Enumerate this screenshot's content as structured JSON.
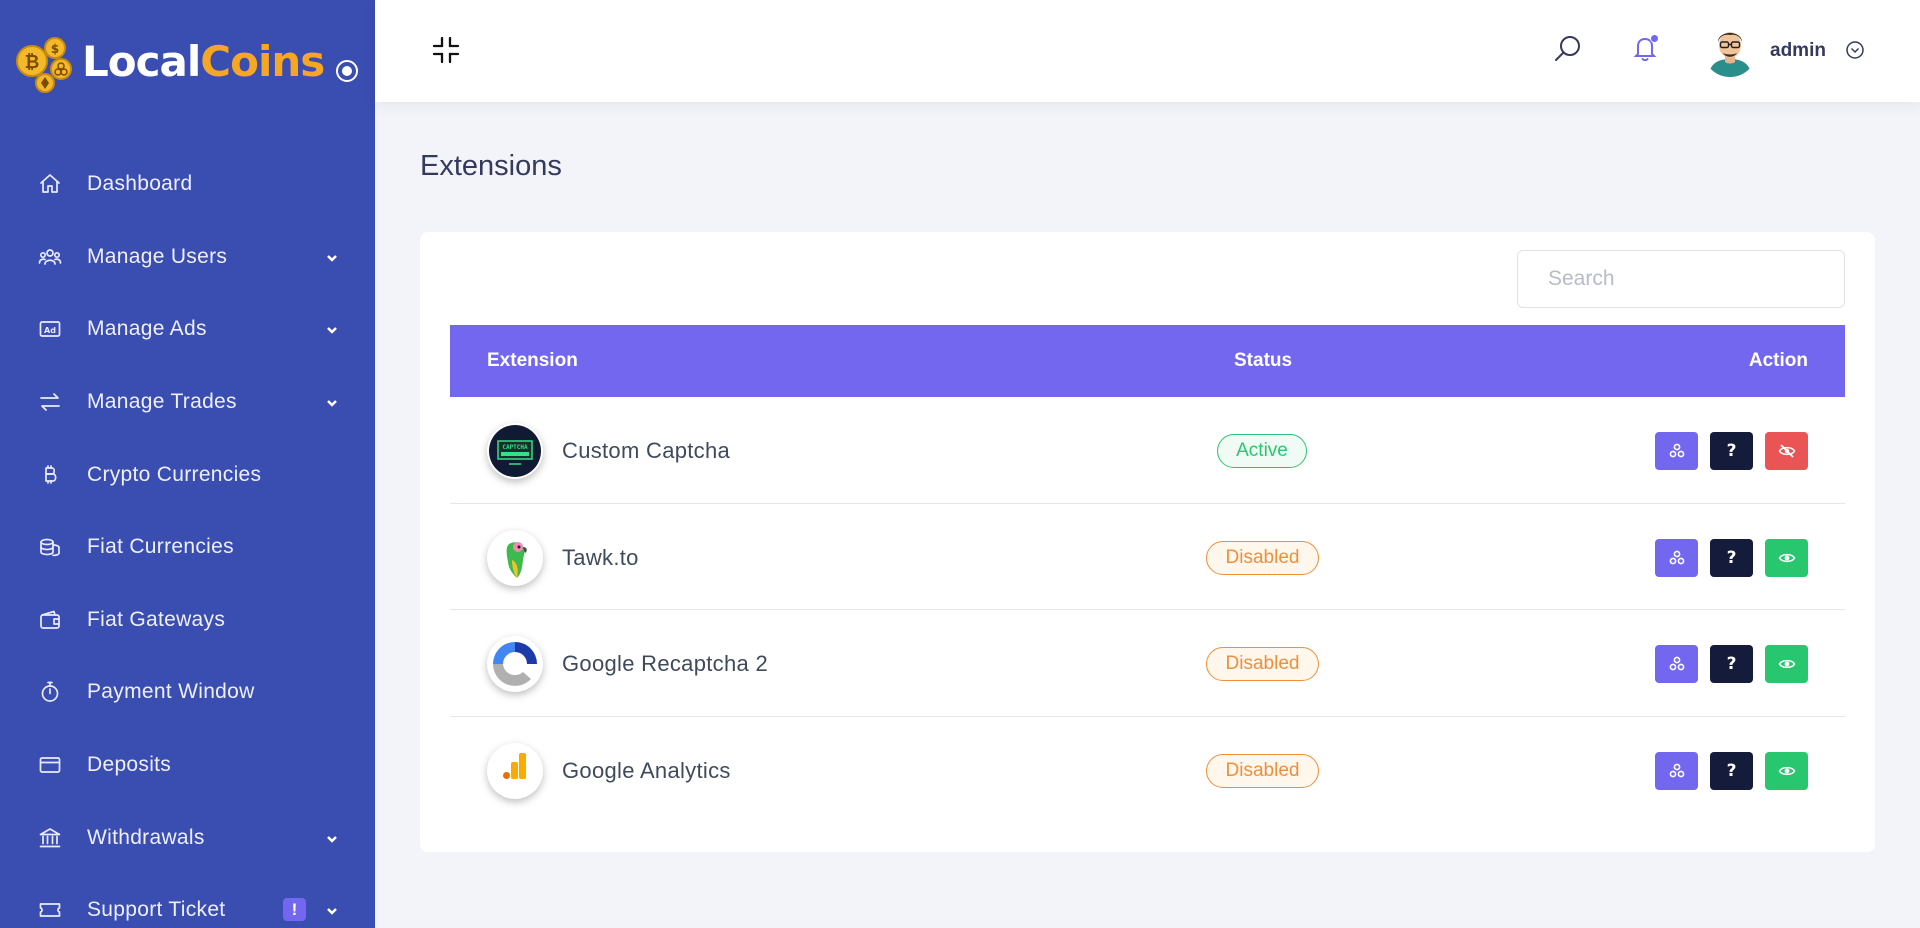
{
  "brand": {
    "name_part1": "Local",
    "name_part2": "Coins"
  },
  "sidebar": {
    "items": [
      {
        "label": "Dashboard",
        "icon": "home-icon",
        "has_submenu": false
      },
      {
        "label": "Manage Users",
        "icon": "users-icon",
        "has_submenu": true
      },
      {
        "label": "Manage Ads",
        "icon": "ad-icon",
        "has_submenu": true
      },
      {
        "label": "Manage Trades",
        "icon": "exchange-icon",
        "has_submenu": true
      },
      {
        "label": "Crypto Currencies",
        "icon": "bitcoin-icon",
        "has_submenu": false
      },
      {
        "label": "Fiat Currencies",
        "icon": "coins-icon",
        "has_submenu": false
      },
      {
        "label": "Fiat Gateways",
        "icon": "wallet-icon",
        "has_submenu": false
      },
      {
        "label": "Payment Window",
        "icon": "stopwatch-icon",
        "has_submenu": false
      },
      {
        "label": "Deposits",
        "icon": "credit-card-icon",
        "has_submenu": false
      },
      {
        "label": "Withdrawals",
        "icon": "bank-icon",
        "has_submenu": true
      },
      {
        "label": "Support Ticket",
        "icon": "ticket-icon",
        "has_submenu": true,
        "badge": "!"
      }
    ]
  },
  "topbar": {
    "user_name": "admin",
    "icons": [
      "collapse-icon",
      "search-icon",
      "bell-icon",
      "avatar",
      "chevron-down-icon"
    ]
  },
  "page": {
    "title": "Extensions"
  },
  "search": {
    "placeholder": "Search"
  },
  "table": {
    "headers": {
      "extension": "Extension",
      "status": "Status",
      "action": "Action"
    },
    "rows": [
      {
        "name": "Custom Captcha",
        "status": "Active",
        "status_type": "active",
        "logo": "captcha-logo",
        "toggle_action": "disable"
      },
      {
        "name": "Tawk.to",
        "status": "Disabled",
        "status_type": "disabled",
        "logo": "tawkto-parrot-logo",
        "toggle_action": "enable"
      },
      {
        "name": "Google Recaptcha 2",
        "status": "Disabled",
        "status_type": "disabled",
        "logo": "recaptcha-logo",
        "toggle_action": "enable"
      },
      {
        "name": "Google Analytics",
        "status": "Disabled",
        "status_type": "disabled",
        "logo": "google-analytics-logo",
        "toggle_action": "enable"
      }
    ]
  },
  "colors": {
    "sidebar_bg": "#3a4db1",
    "primary": "#7367f0",
    "success": "#28c76f",
    "danger": "#ea5455",
    "warning": "#f08f3a",
    "dark": "#151b3b",
    "brand_accent": "#f5a623"
  }
}
